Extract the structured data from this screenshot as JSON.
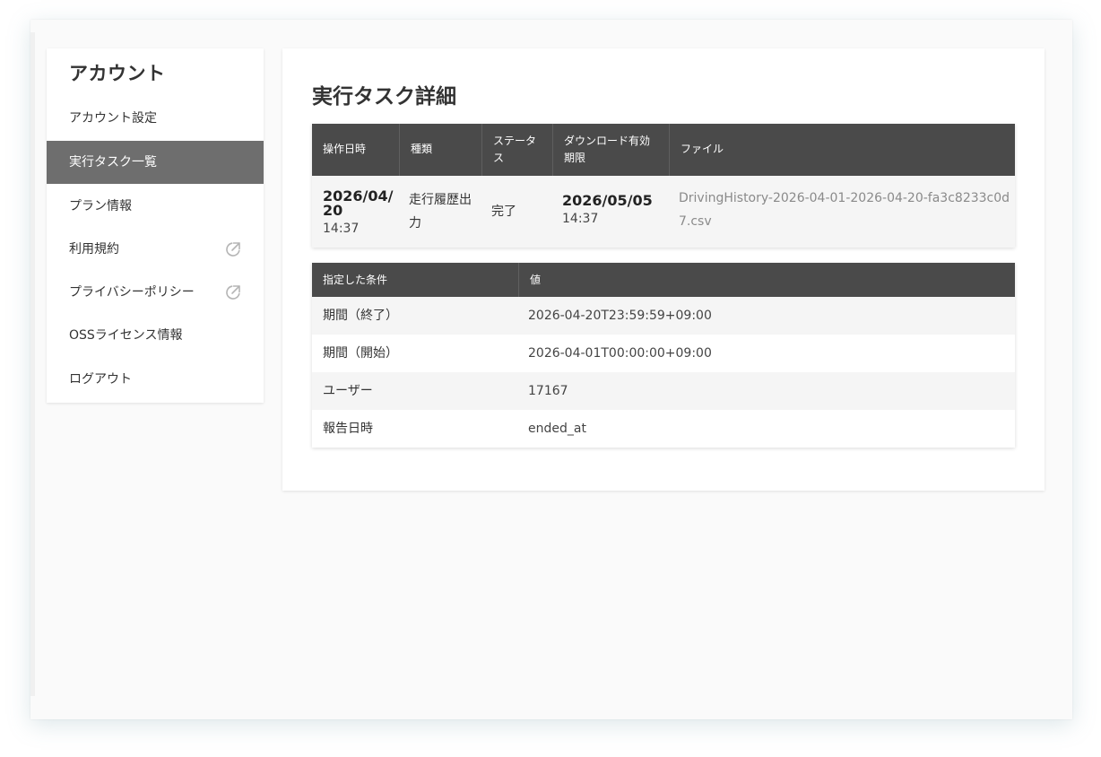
{
  "sidebar": {
    "title": "アカウント",
    "items": [
      {
        "label": "アカウント設定",
        "active": false,
        "external": false
      },
      {
        "label": "実行タスク一覧",
        "active": true,
        "external": false
      },
      {
        "label": "プラン情報",
        "active": false,
        "external": false
      },
      {
        "label": "利用規約",
        "active": false,
        "external": true
      },
      {
        "label": "プライバシーポリシー",
        "active": false,
        "external": true
      },
      {
        "label": "OSSライセンス情報",
        "active": false,
        "external": false
      },
      {
        "label": "ログアウト",
        "active": false,
        "external": false
      }
    ]
  },
  "main": {
    "title": "実行タスク詳細",
    "task_table": {
      "headers": [
        "操作日時",
        "種類",
        "ステータス",
        "ダウンロード有効期限",
        "ファイル"
      ],
      "row": {
        "operated_date": "2026/04/20",
        "operated_time": "14:37",
        "type": "走行履歴出力",
        "status": "完了",
        "expiry_date": "2026/05/05",
        "expiry_time": "14:37",
        "file": "DrivingHistory-2026-04-01-2026-04-20-fa3c8233c0d7.csv"
      }
    },
    "conditions_table": {
      "headers": [
        "指定した条件",
        "値"
      ],
      "rows": [
        {
          "label": "期間（終了）",
          "value": "2026-04-20T23:59:59+09:00"
        },
        {
          "label": "期間（開始）",
          "value": "2026-04-01T00:00:00+09:00"
        },
        {
          "label": "ユーザー",
          "value": "17167"
        },
        {
          "label": "報告日時",
          "value": "ended_at"
        }
      ]
    }
  },
  "colors": {
    "header_bg": "#4a4a4a",
    "active_item_bg": "#6e6e6e",
    "row_alt_bg": "#f5f5f5",
    "file_link": "#8a8a8a"
  },
  "icons": {
    "external_link": "external-link-icon"
  }
}
